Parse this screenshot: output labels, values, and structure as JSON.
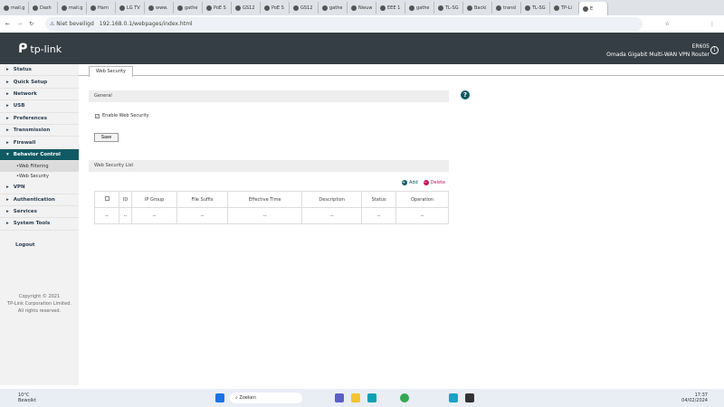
{
  "browser": {
    "tabs": [
      "mail.g",
      "Dash",
      "mail.g",
      "Harn",
      "LG TV",
      "www.",
      "gathe",
      "PoE S",
      "GS12",
      "PoE S",
      "GS12",
      "gathe",
      "Nieuw",
      "EEE 1",
      "gathe",
      "TL-SG",
      "Backi",
      "transl",
      "TL-SG",
      "TP-Li",
      "E"
    ],
    "security_label": "Niet beveiligd",
    "url": "192.168.0.1/webpages/index.html"
  },
  "header": {
    "logo": "tp-link",
    "model": "ER605",
    "product": "Omada Gigabit Multi-WAN VPN Router"
  },
  "sidebar": {
    "items": [
      "Status",
      "Quick Setup",
      "Network",
      "USB",
      "Preferences",
      "Transmission",
      "Firewall",
      "Behavior Control"
    ],
    "subitems": [
      "Web Filtering",
      "Web Security"
    ],
    "items_after": [
      "VPN",
      "Authentication",
      "Services",
      "System Tools"
    ],
    "logout": "Logout",
    "copyright": [
      "Copyright © 2021",
      "TP-Link Corporation Limited.",
      "All rights reserved."
    ]
  },
  "main": {
    "tab": "Web Security",
    "general": "General",
    "enable_label": "Enable Web Security",
    "save": "Save",
    "list_title": "Web Security List",
    "add": "Add",
    "delete": "Delete",
    "columns": [
      "ID",
      "IP Group",
      "File Suffix",
      "Effective Time",
      "Description",
      "Status",
      "Operation"
    ],
    "row": [
      "--",
      "--",
      "--",
      "--",
      "--",
      "--",
      "--",
      "--"
    ]
  },
  "taskbar": {
    "weather_temp": "10°C",
    "weather_desc": "Bewolkt",
    "search": "Zoeken",
    "time": "17:37",
    "date": "04/02/2024"
  }
}
